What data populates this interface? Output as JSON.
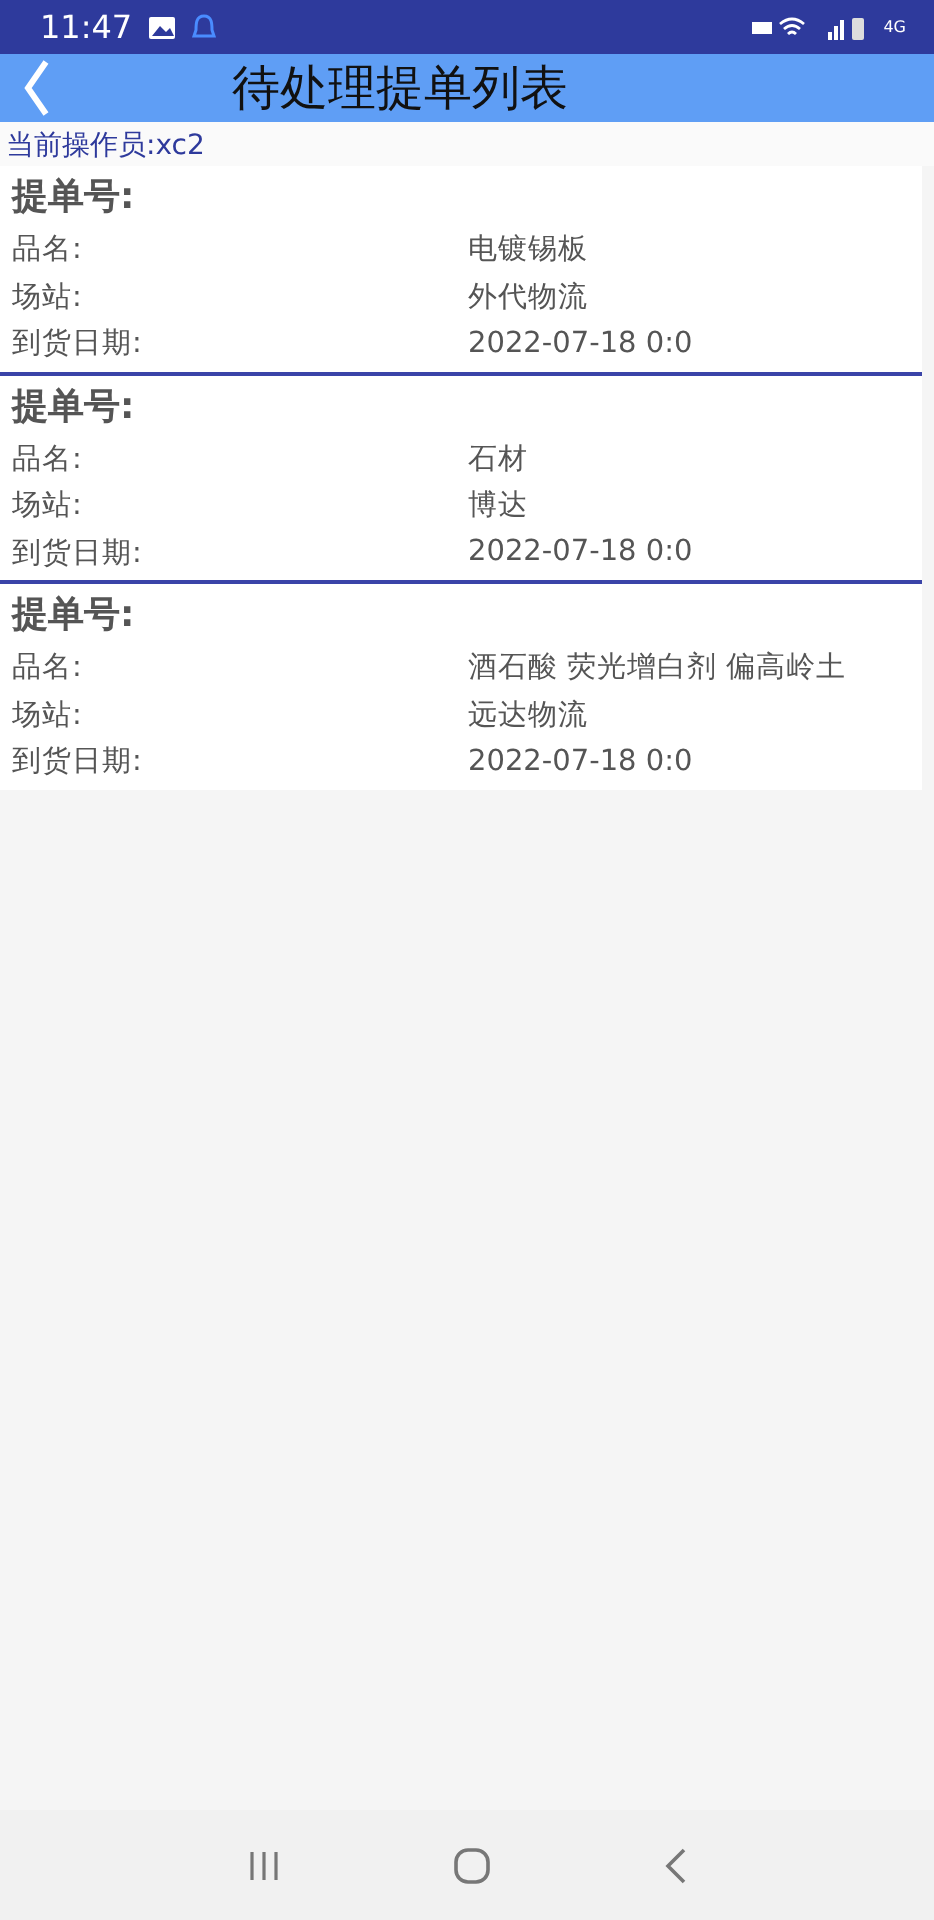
{
  "status_bar": {
    "time": "11:47",
    "network": "4G"
  },
  "header": {
    "title": "待处理提单列表"
  },
  "operator": "当前操作员:xc2",
  "orders": [
    {
      "title": "提单号:",
      "fields": [
        {
          "label": "品名:",
          "value": "电镀锡板"
        },
        {
          "label": "场站:",
          "value": "外代物流"
        },
        {
          "label": "到货日期:",
          "value": "2022-07-18  0:0"
        }
      ]
    },
    {
      "title": "提单号:",
      "fields": [
        {
          "label": "品名:",
          "value": "石材"
        },
        {
          "label": "场站:",
          "value": "博达"
        },
        {
          "label": "到货日期:",
          "value": "2022-07-18  0:0"
        }
      ]
    },
    {
      "title": "提单号:",
      "fields": [
        {
          "label": "品名:",
          "value": "酒石酸  荧光增白剂 偏高岭土"
        },
        {
          "label": "场站:",
          "value": "远达物流"
        },
        {
          "label": "到货日期:",
          "value": "2022-07-18  0:0"
        }
      ]
    }
  ]
}
